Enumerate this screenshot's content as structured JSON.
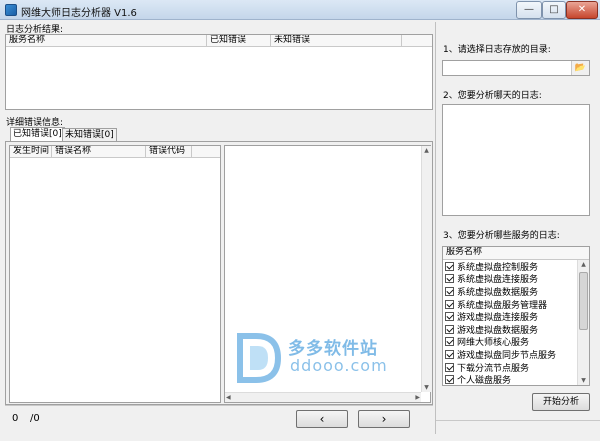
{
  "window": {
    "title": "网维大师日志分析器 V1.6",
    "min_glyph": "—",
    "max_glyph": "□",
    "close_glyph": "✕"
  },
  "log_results": {
    "label": "日志分析结果:",
    "columns": [
      "服务名称",
      "已知错误",
      "未知错误"
    ]
  },
  "details": {
    "label": "详细错误信息:",
    "tabs": [
      "已知错误[0]",
      "未知错误[0]"
    ],
    "columns": [
      "发生时间",
      "错误名称",
      "错误代码"
    ]
  },
  "pager": {
    "current": "0",
    "total": "/0",
    "prev_label": "‹",
    "next_label": "›"
  },
  "right_panel": {
    "step1_label": "1、请选择日志存放的目录:",
    "dir_value": "",
    "folder_icon": "📂",
    "step2_label": "2、您要分析哪天的日志:",
    "step3_label": "3、您要分析哪些服务的日志:",
    "services_header": "服务名称",
    "services": [
      {
        "name": "系统虚拟盘控制服务",
        "checked": true
      },
      {
        "name": "系统虚拟盘连接服务",
        "checked": true
      },
      {
        "name": "系统虚拟盘数据服务",
        "checked": true
      },
      {
        "name": "系统虚拟盘服务管理器",
        "checked": true
      },
      {
        "name": "游戏虚拟盘连接服务",
        "checked": true
      },
      {
        "name": "游戏虚拟盘数据服务",
        "checked": true
      },
      {
        "name": "网维大师核心服务",
        "checked": true
      },
      {
        "name": "游戏虚拟盘同步节点服务",
        "checked": true
      },
      {
        "name": "下载分流节点服务",
        "checked": true
      },
      {
        "name": "个人磁盘服务",
        "checked": true
      }
    ],
    "start_label": "开始分析"
  },
  "watermark": {
    "cn": "多多软件站",
    "en": "ddooo.com",
    "brand_color": "#2d8fd8"
  }
}
